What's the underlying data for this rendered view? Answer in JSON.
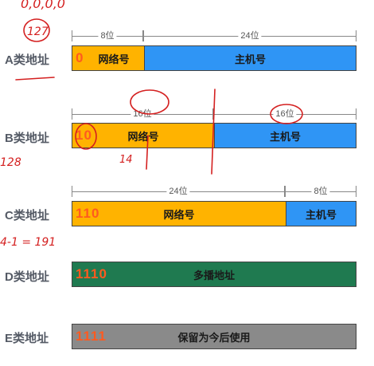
{
  "rows": {
    "a": {
      "label": "A类地址",
      "dims": [
        "8位",
        "24位"
      ],
      "prefix": "0",
      "segments": [
        "网络号",
        "主机号"
      ]
    },
    "b": {
      "label": "B类地址",
      "dims": [
        "16位",
        "16位"
      ],
      "prefix": "10",
      "segments": [
        "网络号",
        "主机号"
      ]
    },
    "c": {
      "label": "C类地址",
      "dims": [
        "24位",
        "8位"
      ],
      "prefix": "110",
      "segments": [
        "网络号",
        "主机号"
      ]
    },
    "d": {
      "label": "D类地址",
      "prefix": "1110",
      "segments": [
        "多播地址"
      ]
    },
    "e": {
      "label": "E类地址",
      "prefix": "1111",
      "segments": [
        "保留为今后使用"
      ]
    }
  },
  "handwriting": {
    "top_numbers": "0,0,0,0",
    "a_circled": "127",
    "b_side": "128",
    "b_under": "14",
    "c_side": "4-1 = 191"
  },
  "colors": {
    "network": "#ffb300",
    "host": "#2f95f5",
    "multicast": "#1f7a50",
    "reserved": "#8a8a8a",
    "prefix": "#ff5a1f",
    "ink": "#d42020"
  }
}
